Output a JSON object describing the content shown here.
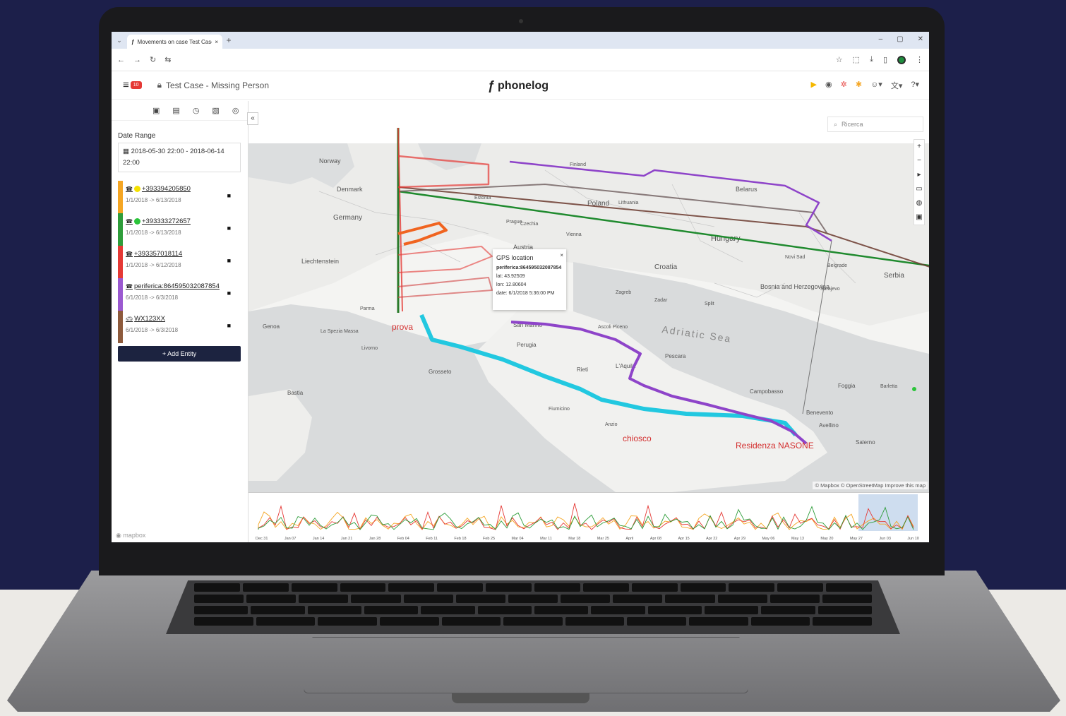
{
  "browser": {
    "tab_title": "Movements on case Test Case",
    "new_tab": "+",
    "tab_close": "×",
    "window_controls": [
      "–",
      "▢",
      "✕"
    ]
  },
  "header": {
    "badge": "10",
    "case_title": "Test Case - Missing Person",
    "brand": "phonelog",
    "icon_colors": [
      "#f5b800",
      "#555555",
      "#e53935",
      "#f5a623",
      "#555555",
      "#555555",
      "#555555"
    ]
  },
  "sidebar": {
    "date_label": "Date Range",
    "date_value": "2018-05-30 22:00 - 2018-06-14 22:00",
    "entities": [
      {
        "id": "+393394205850",
        "range": "1/1/2018 -> 6/13/2018",
        "color": "#f5a623",
        "dot": "#f5e100",
        "icon": "phone-icon"
      },
      {
        "id": "+393333272657",
        "range": "1/1/2018 -> 6/13/2018",
        "color": "#2e9d3a",
        "dot": "#2bc43a",
        "icon": "phone-icon"
      },
      {
        "id": "+393357018114",
        "range": "1/1/2018 -> 6/12/2018",
        "color": "#e53935",
        "dot": "",
        "icon": "phone-icon"
      },
      {
        "id": "periferica:864595032087854",
        "range": "6/1/2018 -> 6/3/2018",
        "color": "#9b59d0",
        "dot": "",
        "icon": "phone-icon"
      },
      {
        "id": "WX123XX",
        "range": "6/1/2018 -> 6/3/2018",
        "color": "#8d5a3c",
        "dot": "",
        "icon": "car-icon"
      }
    ],
    "add_entity": "+ Add Entity"
  },
  "map": {
    "search_placeholder": "Ricerca",
    "attribution": "© Mapbox © OpenStreetMap Improve this map",
    "popup": {
      "title": "GPS location",
      "entity": "periferica:864595032087854",
      "lat": "lat: 43.92509",
      "lon": "lon: 12.80604",
      "date": "date: 6/1/2018 5:36:00 PM"
    },
    "labels": [
      "Norway",
      "Denmark",
      "Germany",
      "Poland",
      "Belarus",
      "Czechia",
      "Austria",
      "Hungary",
      "Croatia",
      "Serbia",
      "Bosnia and Herzegovina",
      "Liechtenstein",
      "Adriatic Sea",
      "Perugia",
      "Grosseto",
      "Rieti",
      "L'Aquila",
      "Pescara",
      "Foggia",
      "Campobasso",
      "Benevento",
      "Avellino",
      "Salerno",
      "Anzio",
      "Fiumicino",
      "Bastia",
      "Genoa",
      "Parma",
      "Livorno",
      "La Spezia Massa",
      "San Marino",
      "Ascoli Piceno",
      "Barletta",
      "Estonia",
      "Lithuania",
      "Zagreb",
      "Sarajevo",
      "Belgrade",
      "Split",
      "Zadar",
      "Novi Sad",
      "Finland",
      "Prague",
      "Vienna"
    ],
    "markers": {
      "prova": "prova",
      "chiosco": "chiosco",
      "residenza": "Residenza NASONE"
    },
    "colors": {
      "cyan": "#22c8e0",
      "purple": "#8e44c9",
      "green": "#1f8a2e",
      "red": "#e53935",
      "brown": "#6b3a2e",
      "orange": "#f06420"
    }
  },
  "timeline": {
    "ticks": [
      "Dec 31",
      "Jan 07",
      "Jan 14",
      "Jan 21",
      "Jan 28",
      "Feb 04",
      "Feb 11",
      "Feb 18",
      "Feb 25",
      "Mar 04",
      "Mar 11",
      "Mar 18",
      "Mar 25",
      "April",
      "Apr 08",
      "Apr 15",
      "Apr 22",
      "Apr 29",
      "May 06",
      "May 13",
      "May 20",
      "May 27",
      "Jun 03",
      "Jun 10"
    ]
  }
}
